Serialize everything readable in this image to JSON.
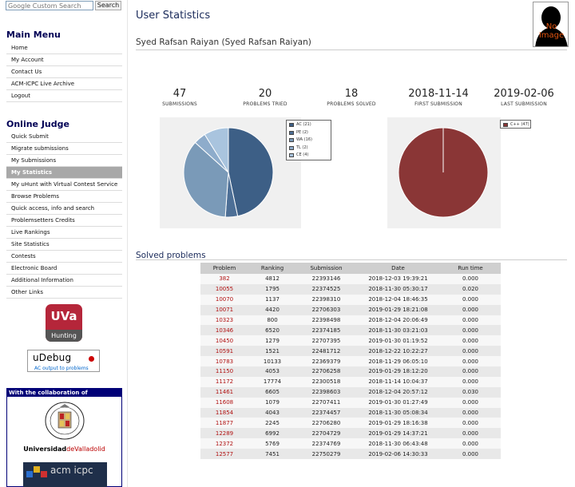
{
  "search": {
    "placeholder": "Google Custom Search",
    "button": "Search"
  },
  "main_menu": {
    "title": "Main Menu",
    "items": [
      "Home",
      "My Account",
      "Contact Us",
      "ACM-ICPC Live Archive",
      "Logout"
    ]
  },
  "online_judge": {
    "title": "Online Judge",
    "active": "My Statistics",
    "items": [
      "Quick Submit",
      "Migrate submissions",
      "My Submissions",
      "My Statistics",
      "My uHunt with Virtual Contest Service",
      "Browse Problems",
      "Quick access, info and search",
      "Problemsetters Credits",
      "Live Rankings",
      "Site Statistics",
      "Contests",
      "Electronic Board",
      "Additional Information",
      "Other Links"
    ]
  },
  "uva_logo": {
    "title": "UVa",
    "subtitle": "Hunting"
  },
  "udebug": {
    "title": "uDebug",
    "subtitle": "AC output to problems"
  },
  "collab": {
    "title": "With the collaboration of",
    "university": "Universidad",
    "university_suffix": "deValladolid",
    "icpc": "acm icpc"
  },
  "page_title": "User Statistics",
  "avatar": {
    "label": "No Image"
  },
  "user_name": "Syed Rafsan Raiyan (Syed Rafsan Raiyan)",
  "stats": [
    {
      "value": "47",
      "label": "SUBMISSIONS"
    },
    {
      "value": "20",
      "label": "PROBLEMS TRIED"
    },
    {
      "value": "18",
      "label": "PROBLEMS SOLVED"
    },
    {
      "value": "2018-11-14",
      "label": "FIRST SUBMISSION"
    },
    {
      "value": "2019-02-06",
      "label": "LAST SUBMISSION"
    }
  ],
  "chart_data": [
    {
      "type": "pie",
      "categories": [
        "AC",
        "PE",
        "WA",
        "TL",
        "CE"
      ],
      "values": [
        21,
        2,
        16,
        2,
        4
      ],
      "legend_labels": [
        "AC (21)",
        "PE (2)",
        "WA (16)",
        "TL (2)",
        "CE (4)"
      ],
      "colors": [
        "#3d5f86",
        "#4d6f96",
        "#7a9ab8",
        "#8eaccb",
        "#a9c4de"
      ],
      "legend": "right"
    },
    {
      "type": "pie",
      "categories": [
        "C++"
      ],
      "values": [
        47
      ],
      "legend_labels": [
        "C++ (47)"
      ],
      "colors": [
        "#8a3636"
      ],
      "legend": "top-right"
    }
  ],
  "solved_title": "Solved problems",
  "table": {
    "headers": [
      "Problem",
      "Ranking",
      "Submission",
      "Date",
      "Run time"
    ],
    "rows": [
      [
        "382",
        "4812",
        "22393146",
        "2018-12-03 19:39:21",
        "0.000"
      ],
      [
        "10055",
        "1795",
        "22374525",
        "2018-11-30 05:30:17",
        "0.020"
      ],
      [
        "10070",
        "1137",
        "22398310",
        "2018-12-04 18:46:35",
        "0.000"
      ],
      [
        "10071",
        "4420",
        "22706303",
        "2019-01-29 18:21:08",
        "0.000"
      ],
      [
        "10323",
        "800",
        "22398498",
        "2018-12-04 20:06:49",
        "0.000"
      ],
      [
        "10346",
        "6520",
        "22374185",
        "2018-11-30 03:21:03",
        "0.000"
      ],
      [
        "10450",
        "1279",
        "22707395",
        "2019-01-30 01:19:52",
        "0.000"
      ],
      [
        "10591",
        "1521",
        "22481712",
        "2018-12-22 10:22:27",
        "0.000"
      ],
      [
        "10783",
        "10133",
        "22369379",
        "2018-11-29 06:05:10",
        "0.000"
      ],
      [
        "11150",
        "4053",
        "22706258",
        "2019-01-29 18:12:20",
        "0.000"
      ],
      [
        "11172",
        "17774",
        "22300518",
        "2018-11-14 10:04:37",
        "0.000"
      ],
      [
        "11461",
        "6605",
        "22398603",
        "2018-12-04 20:57:12",
        "0.030"
      ],
      [
        "11608",
        "1079",
        "22707411",
        "2019-01-30 01:27:49",
        "0.000"
      ],
      [
        "11854",
        "4043",
        "22374457",
        "2018-11-30 05:08:34",
        "0.000"
      ],
      [
        "11877",
        "2245",
        "22706280",
        "2019-01-29 18:16:38",
        "0.000"
      ],
      [
        "12289",
        "6992",
        "22704729",
        "2019-01-29 14:37:21",
        "0.000"
      ],
      [
        "12372",
        "5769",
        "22374769",
        "2018-11-30 06:43:48",
        "0.000"
      ],
      [
        "12577",
        "7451",
        "22750279",
        "2019-02-06 14:30:33",
        "0.000"
      ]
    ]
  }
}
